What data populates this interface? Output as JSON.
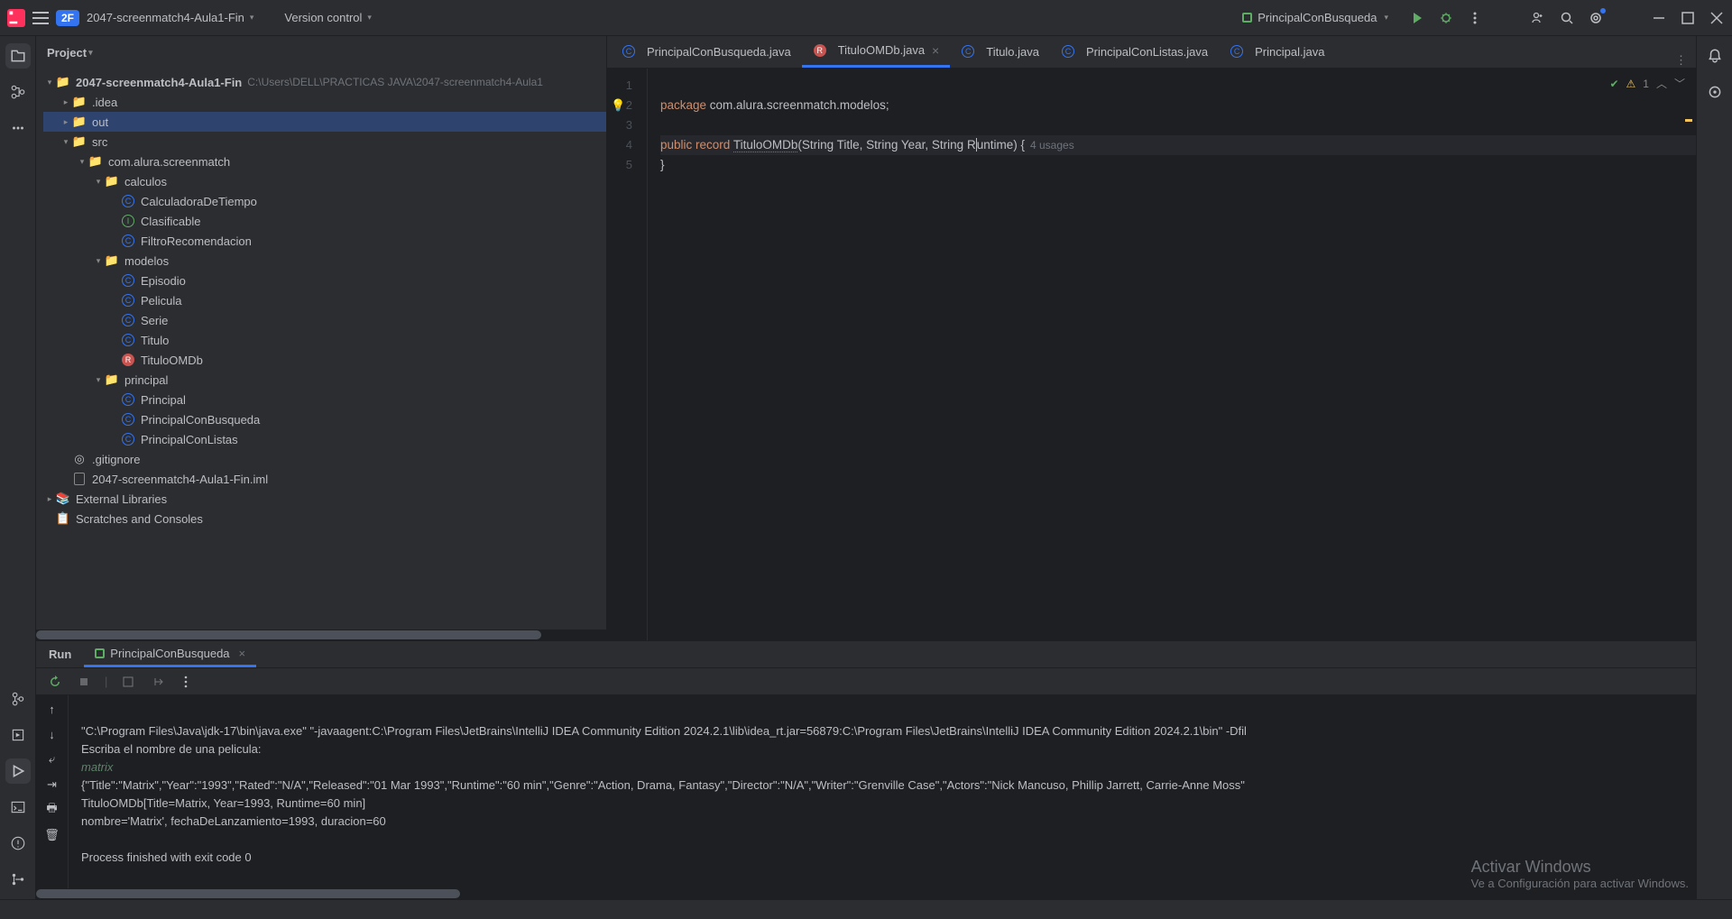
{
  "title_bar": {
    "project_badge": "2F",
    "project_name": "2047-screenmatch4-Aula1-Fin",
    "vcs_label": "Version control",
    "run_config": "PrincipalConBusqueda"
  },
  "project": {
    "header": "Project",
    "root_name": "2047-screenmatch4-Aula1-Fin",
    "root_path": "C:\\Users\\DELL\\PRACTICAS JAVA\\2047-screenmatch4-Aula1",
    "idea": ".idea",
    "out": "out",
    "src": "src",
    "pkg1": "com.alura.screenmatch",
    "pkg_calculos": "calculos",
    "cls_calculadora": "CalculadoraDeTiempo",
    "cls_clasificable": "Clasificable",
    "cls_filtro": "FiltroRecomendacion",
    "pkg_modelos": "modelos",
    "cls_episodio": "Episodio",
    "cls_pelicula": "Pelicula",
    "cls_serie": "Serie",
    "cls_titulo": "Titulo",
    "cls_tituloomdb": "TituloOMDb",
    "pkg_principal": "principal",
    "cls_principal": "Principal",
    "cls_principalcb": "PrincipalConBusqueda",
    "cls_principalcl": "PrincipalConListas",
    "gitignore": ".gitignore",
    "iml": "2047-screenmatch4-Aula1-Fin.iml",
    "external": "External Libraries",
    "scratches": "Scratches and Consoles"
  },
  "tabs": [
    {
      "label": "PrincipalConBusqueda.java",
      "active": false
    },
    {
      "label": "TituloOMDb.java",
      "active": true
    },
    {
      "label": "Titulo.java",
      "active": false
    },
    {
      "label": "PrincipalConListas.java",
      "active": false
    },
    {
      "label": "Principal.java",
      "active": false
    }
  ],
  "editor": {
    "line1_kw": "package",
    "line1_rest": " com.alura.screenmatch.modelos;",
    "line3_kw1": "public",
    "line3_kw2": "record",
    "line3_name": "TituloOMDb",
    "line3_params": "(String Title, String Year, String R",
    "line3_params2": "untime) {",
    "line3_usages": "4 usages",
    "line4": "}",
    "warn_count": "1"
  },
  "run": {
    "title": "Run",
    "tab": "PrincipalConBusqueda",
    "console_line1": "\"C:\\Program Files\\Java\\jdk-17\\bin\\java.exe\" \"-javaagent:C:\\Program Files\\JetBrains\\IntelliJ IDEA Community Edition 2024.2.1\\lib\\idea_rt.jar=56879:C:\\Program Files\\JetBrains\\IntelliJ IDEA Community Edition 2024.2.1\\bin\" -Dfil",
    "console_line2": "Escriba el nombre de una pelicula:",
    "console_line3": "matrix",
    "console_line4": "{\"Title\":\"Matrix\",\"Year\":\"1993\",\"Rated\":\"N/A\",\"Released\":\"01 Mar 1993\",\"Runtime\":\"60 min\",\"Genre\":\"Action, Drama, Fantasy\",\"Director\":\"N/A\",\"Writer\":\"Grenville Case\",\"Actors\":\"Nick Mancuso, Phillip Jarrett, Carrie-Anne Moss\"",
    "console_line5": "TituloOMDb[Title=Matrix, Year=1993, Runtime=60 min]",
    "console_line6": "nombre='Matrix', fechaDeLanzamiento=1993, duracion=60",
    "console_line7": "",
    "console_line8": "Process finished with exit code 0"
  },
  "watermark": {
    "line1": "Activar Windows",
    "line2": "Ve a Configuración para activar Windows."
  }
}
